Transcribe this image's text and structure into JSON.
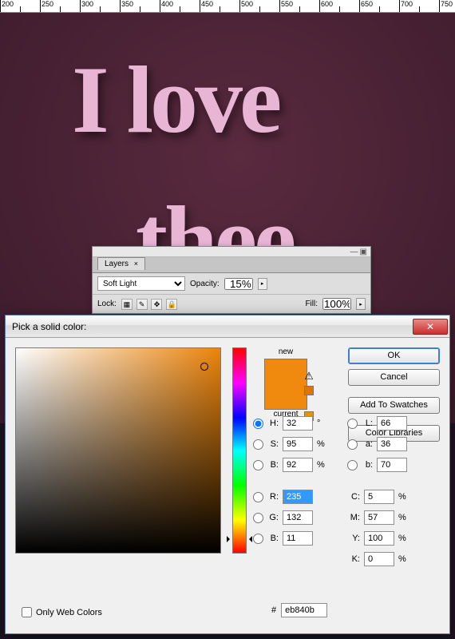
{
  "ruler": {
    "start": 200,
    "step": 50,
    "count": 23
  },
  "canvas": {
    "line1": "I love",
    "line2": "thee"
  },
  "layers": {
    "tab_label": "Layers",
    "blend_mode": "Soft Light",
    "opacity_label": "Opacity:",
    "opacity_value": "15%",
    "lock_label": "Lock:",
    "fill_label": "Fill:",
    "fill_value": "100%"
  },
  "dialog": {
    "title": "Pick a solid color:",
    "ok_label": "OK",
    "cancel_label": "Cancel",
    "add_swatch_label": "Add To Swatches",
    "color_lib_label": "Color Libraries",
    "new_label": "new",
    "current_label": "current",
    "owc_label": "Only Web Colors",
    "hex_value": "eb840b",
    "hsb": {
      "h_lab": "H:",
      "h": "32",
      "h_u": "°",
      "s_lab": "S:",
      "s": "95",
      "s_u": "%",
      "b_lab": "B:",
      "b": "92",
      "b_u": "%"
    },
    "rgb": {
      "r_lab": "R:",
      "r": "235",
      "g_lab": "G:",
      "g": "132",
      "b_lab": "B:",
      "b": "11"
    },
    "lab": {
      "l_lab": "L:",
      "l": "66",
      "a_lab": "a:",
      "a": "36",
      "b_lab": "b:",
      "b": "70"
    },
    "cmyk": {
      "c_lab": "C:",
      "c": "5",
      "m_lab": "M:",
      "m": "57",
      "y_lab": "Y:",
      "y": "100",
      "k_lab": "K:",
      "k": "0",
      "u": "%"
    },
    "hue_position_pct": 91
  }
}
